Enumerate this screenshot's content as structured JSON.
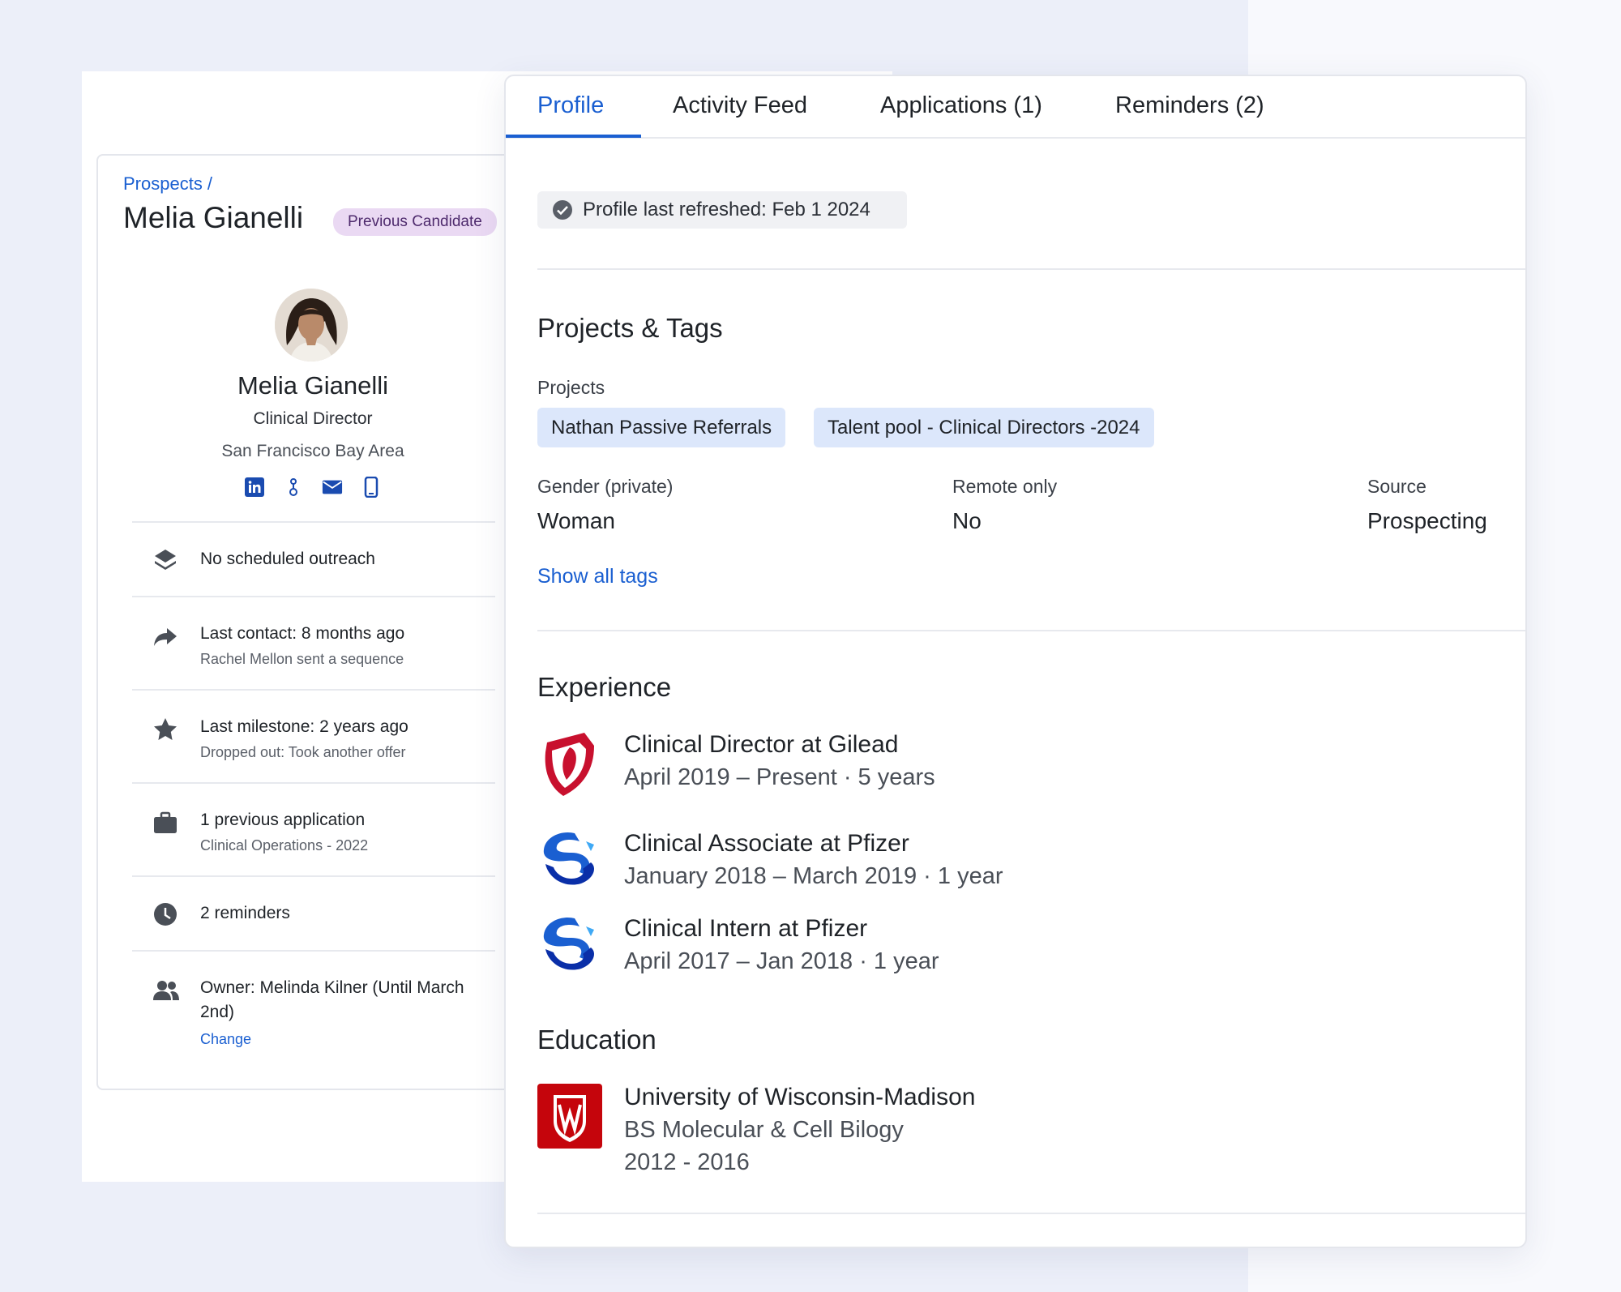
{
  "sidebar": {
    "breadcrumb": "Prospects /",
    "name": "Melia Gianelli",
    "badge": "Previous Candidate",
    "card_name": "Melia Gianelli",
    "title": "Clinical Director",
    "location": "San Francisco Bay Area",
    "social_icons": [
      "linkedin-icon",
      "github-icon",
      "email-icon",
      "phone-icon"
    ],
    "items": [
      {
        "icon": "layers-icon",
        "main": "No scheduled outreach"
      },
      {
        "icon": "share-arrow-icon",
        "main": "Last contact: 8 months ago",
        "sub": "Rachel Mellon sent a sequence"
      },
      {
        "icon": "star-icon",
        "main": "Last milestone: 2 years ago",
        "sub": "Dropped out: Took another offer"
      },
      {
        "icon": "briefcase-icon",
        "main": "1 previous application",
        "sub": "Clinical Operations - 2022"
      },
      {
        "icon": "clock-icon",
        "main": "2 reminders"
      },
      {
        "icon": "people-icon",
        "main": "Owner: Melinda Kilner (Until March 2nd)",
        "link": "Change"
      }
    ]
  },
  "tabs": [
    "Profile",
    "Activity Feed",
    "Applications (1)",
    "Reminders (2)"
  ],
  "active_tab": "Profile",
  "refresh": {
    "label": "Profile last refreshed: Feb 1 2024"
  },
  "projects_tags": {
    "title": "Projects & Tags",
    "projects_label": "Projects",
    "projects": [
      "Nathan Passive Referrals",
      "Talent pool - Clinical Directors -2024"
    ],
    "fields": [
      {
        "label": "Gender (private)",
        "value": "Woman"
      },
      {
        "label": "Remote only",
        "value": "No"
      },
      {
        "label": "Source",
        "value": "Prospecting"
      }
    ],
    "show_all": "Show all tags"
  },
  "experience": {
    "title": "Experience",
    "items": [
      {
        "logo": "gilead-logo",
        "title": "Clinical Director at Gilead",
        "dates": "April 2019 – Present  · 5 years"
      },
      {
        "logo": "pfizer-logo",
        "title": "Clinical Associate at Pfizer",
        "dates": "January 2018 – March 2019  · 1 year"
      },
      {
        "logo": "pfizer-logo",
        "title": "Clinical Intern at Pfizer",
        "dates": "April 2017 – Jan 2018  · 1 year"
      }
    ]
  },
  "education": {
    "title": "Education",
    "school": "University of Wisconsin-Madison",
    "degree": "BS Molecular & Cell Bilogy",
    "years": "2012 - 2016",
    "logo": "uw-madison-logo"
  },
  "colors": {
    "accent": "#1a5fd1",
    "badge_bg": "#ead9f3",
    "chip_bg": "#dce7fb"
  }
}
